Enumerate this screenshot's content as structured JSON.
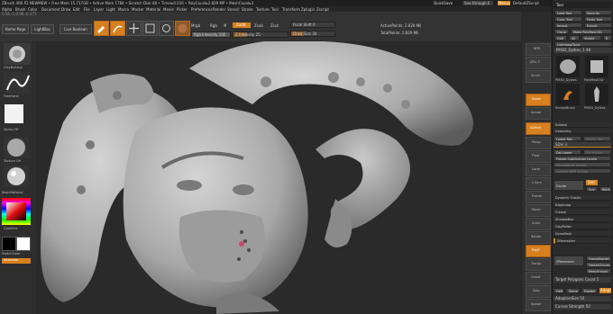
{
  "menubar": {
    "status": "ZBrush 4R6 P2   NEWMEW  • Free Mem 15.717GB • Active Mem 1784 • Scratch Disk 48 • Timer▸0.016 • PolyCount▸2.829 MP • MeshCount▸3",
    "quicksave": "QuickSave",
    "see_through": "See-through 0",
    "menus_btn": "Menus",
    "script_label": "DefaultZScript",
    "menu_items": [
      "Alpha",
      "Brush",
      "Color",
      "Document",
      "Draw",
      "Edit",
      "File",
      "Layer",
      "Light",
      "Macro",
      "Marker",
      "Material",
      "Movie",
      "Picker",
      "Preferences",
      "Render",
      "Stencil",
      "Stroke",
      "Texture",
      "Tool",
      "Transform",
      "Zplugin",
      "Zscript"
    ],
    "coords": "0.56,-1,0.96,-0.277"
  },
  "toolbar": {
    "home_page": "Home Page",
    "lightbox": "LightBox",
    "live_boolean": "Live Boolean",
    "edit_label": "Edit",
    "draw_label": "Draw",
    "move_label": "Move",
    "scale_label": "Scale",
    "rotate_label": "Rotate",
    "mrgb": "Mrgb",
    "rgb": "Rgb",
    "m": "M",
    "zadd": "Zadd",
    "zsub": "Zsub",
    "zcut": "Zcut",
    "rgb_intensity": "Rgb Intensity 100",
    "z_intensity": "Z Intensity 25",
    "focal_shift": "Focal Shift 0",
    "draw_size": "Draw Size 30",
    "active_points": "ActivePoints: 2.829 Mil",
    "total_points": "TotalPoints: 2.829 Mil",
    "rgb_intensity_level": 1.0,
    "z_intensity_level": 0.25,
    "draw_size_level": 0.3
  },
  "leftshelf": {
    "brush_label": "ClayBuildup",
    "stroke_label": "FreeHand",
    "alpha_label": "Alpha Off",
    "texture_label": "Texture Off",
    "material_label": "BasicMaterial",
    "gradient_label": "Gradient",
    "switch_color": "SwitchColor",
    "alternate": "Alternate"
  },
  "rightshelf": {
    "items": [
      "BPR",
      "SPix 3",
      "Scroll",
      "Zoom",
      "Actual",
      "AAHalf",
      "Persp",
      "Floor",
      "Local",
      "L.Sym",
      "Frame",
      "Move",
      "Scale",
      "Rotate",
      "PolyF",
      "Transp",
      "Ghost",
      "Solo",
      "Xpose"
    ]
  },
  "toolpalette": {
    "title": "Tool",
    "load_tool": "Load Tool",
    "save_as": "Save As",
    "copy_tool": "Copy Tool",
    "paste_tool": "Paste Tool",
    "import": "Import",
    "export": "Export",
    "clone": "Clone",
    "make_polymesh": "Make PolyMesh3D",
    "goz": "GoZ",
    "all": "All",
    "visible": "Visible",
    "r": "R",
    "lightbox_tools": "Lightbox▸Tools",
    "current_tool": "PM3D_Dylbes_1 48",
    "thumbs": [
      "PM3D_Dylbes",
      "PolyMesh3D",
      "SimpleBrush",
      "PM3D_Dylbes"
    ],
    "subtool": "Subtool",
    "geometry": "Geometry",
    "lower_res": "Lower Res",
    "higher_res": "Higher Res",
    "sdiv": "SDiv 3",
    "del_lower": "Del Lower",
    "del_higher": "Del Higher",
    "freeze_subdiv": "Freeze SubDivision Levels",
    "reconstruct": "Reconstruct Subdiv",
    "convert_bpr": "Convert BPR To Geo",
    "divide": "Divide",
    "smt": "Smt",
    "suv": "Suv",
    "rsuv": "ReUV",
    "dynamic_subdiv": "Dynamic Subdiv",
    "edge_loop": "EdgeLoop",
    "crease": "Crease",
    "shadowbox": "ShadowBox",
    "claypolish": "ClayPolish",
    "dynamesh": "DynaMesh",
    "zremesher": "ZRemesher",
    "zremesher_btn": "ZRemesher",
    "freeze_border": "FreezeBorder",
    "freeze_groups": "FreezeGroups",
    "keep_groups": "KeepGroups",
    "target_poly": "Target Polygons Count 5",
    "half": "Half",
    "same": "Same",
    "double": "Double",
    "adapt": "Adapt",
    "adaptive_size": "AdaptiveSize 50",
    "curves_strength": "Curves Strength 50"
  },
  "colors": {
    "accent": "#d8801f",
    "background": "#2a2a2a",
    "model": "#b8b8b8"
  }
}
